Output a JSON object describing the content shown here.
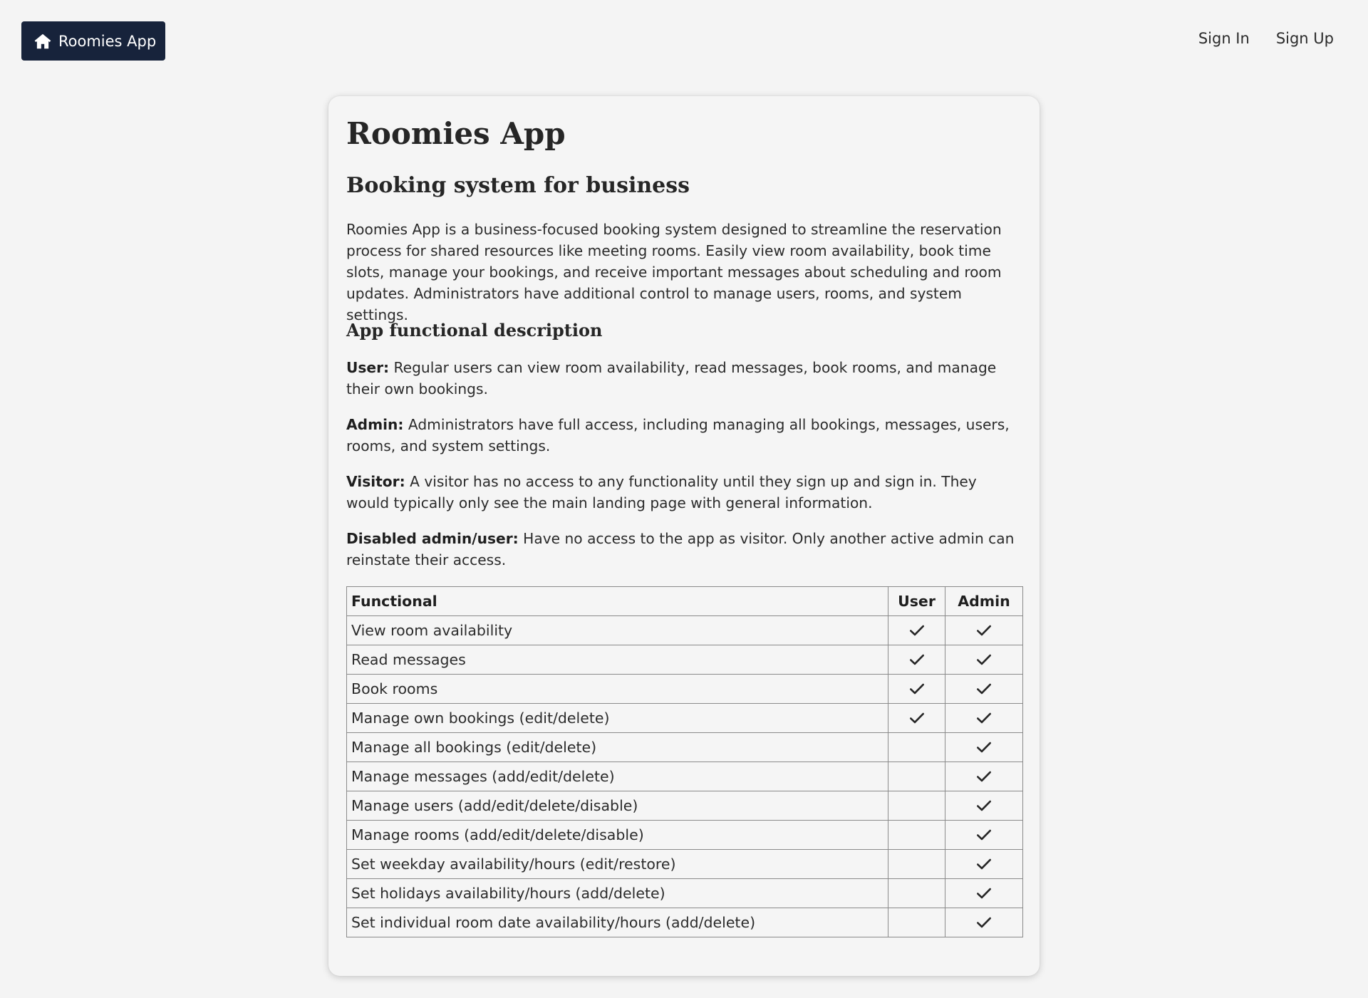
{
  "header": {
    "brand_label": "Roomies App",
    "brand_icon": "home-icon",
    "nav": {
      "sign_in": "Sign In",
      "sign_up": "Sign Up"
    }
  },
  "main": {
    "title": "Roomies App",
    "subtitle": "Booking system for business",
    "intro": "Roomies App is a business-focused booking system designed to streamline the reservation process for shared resources like meeting rooms. Easily view room availability, book time slots, manage your bookings, and receive important messages about scheduling and room updates. Administrators have additional control to manage users, rooms, and system settings.",
    "section_title": "App functional description",
    "roles": {
      "user": {
        "label": "User:",
        "text": " Regular users can view room availability, read messages, book rooms, and manage their own bookings."
      },
      "admin": {
        "label": "Admin:",
        "text": " Administrators have full access, including managing all bookings, messages, users, rooms, and system settings."
      },
      "visitor": {
        "label": "Visitor:",
        "text": " A visitor has no access to any functionality until they sign up and sign in. They would typically only see the main landing page with general information."
      },
      "disabled": {
        "label": "Disabled admin/user:",
        "text": " Have no access to the app as visitor. Only another active admin can reinstate their access."
      }
    },
    "table": {
      "headers": {
        "functional": "Functional",
        "user": "User",
        "admin": "Admin"
      },
      "rows": [
        {
          "label": "View room availability",
          "user": true,
          "admin": true
        },
        {
          "label": "Read messages",
          "user": true,
          "admin": true
        },
        {
          "label": "Book rooms",
          "user": true,
          "admin": true
        },
        {
          "label": "Manage own bookings (edit/delete)",
          "user": true,
          "admin": true
        },
        {
          "label": "Manage all bookings (edit/delete)",
          "user": false,
          "admin": true
        },
        {
          "label": "Manage messages (add/edit/delete)",
          "user": false,
          "admin": true
        },
        {
          "label": "Manage users (add/edit/delete/disable)",
          "user": false,
          "admin": true
        },
        {
          "label": "Manage rooms (add/edit/delete/disable)",
          "user": false,
          "admin": true
        },
        {
          "label": "Set weekday availability/hours (edit/restore)",
          "user": false,
          "admin": true
        },
        {
          "label": "Set holidays availability/hours (add/delete)",
          "user": false,
          "admin": true
        },
        {
          "label": "Set individual room date availability/hours (add/delete)",
          "user": false,
          "admin": true
        }
      ]
    }
  }
}
